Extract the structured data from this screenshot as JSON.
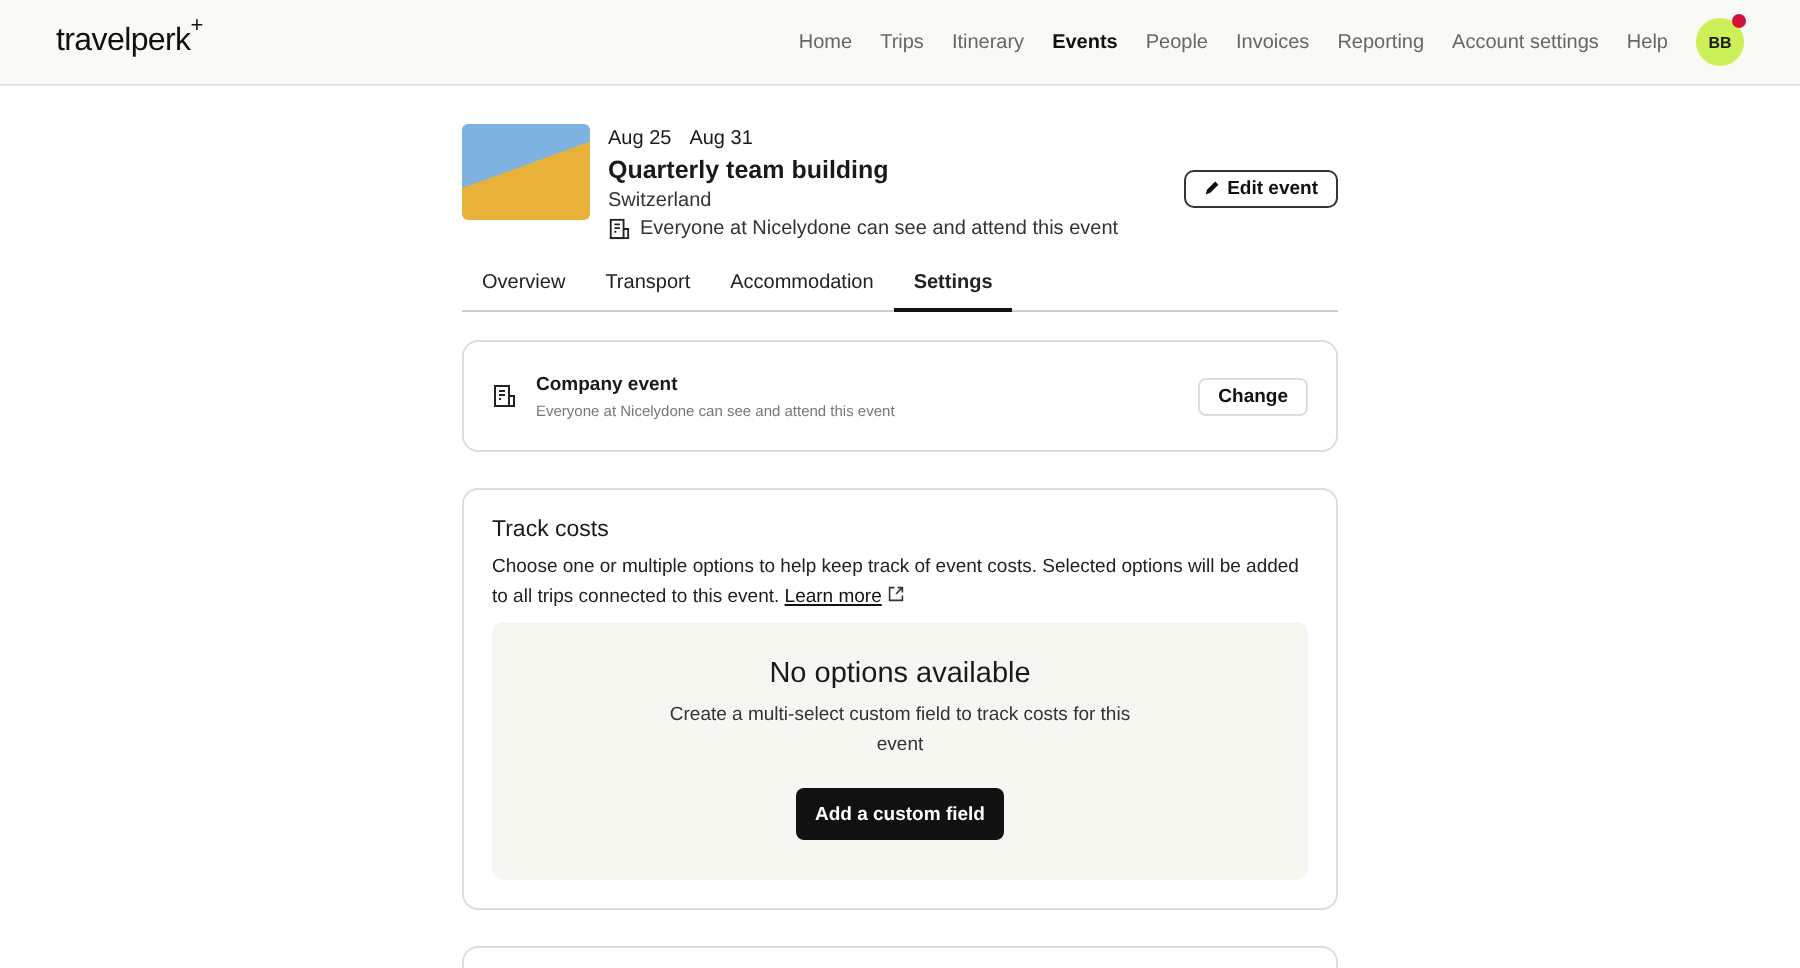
{
  "header": {
    "logo": "travelperk",
    "logo_mark": "+",
    "nav": [
      {
        "label": "Home",
        "selected": false
      },
      {
        "label": "Trips",
        "selected": false
      },
      {
        "label": "Itinerary",
        "selected": false
      },
      {
        "label": "Events",
        "selected": true
      },
      {
        "label": "People",
        "selected": false
      },
      {
        "label": "Invoices",
        "selected": false
      },
      {
        "label": "Reporting",
        "selected": false
      },
      {
        "label": "Account settings",
        "selected": false
      },
      {
        "label": "Help",
        "selected": false
      }
    ],
    "avatar": {
      "initials": "BB",
      "notification": true
    }
  },
  "event": {
    "start": "Aug 25",
    "end": "Aug 31",
    "title": "Quarterly team building",
    "location": "Switzerland",
    "visibility": "Everyone at Nicelydone can see and attend this event",
    "edit_button": "Edit event"
  },
  "tabs": [
    {
      "label": "Overview",
      "selected": false
    },
    {
      "label": "Transport",
      "selected": false
    },
    {
      "label": "Accommodation",
      "selected": false
    },
    {
      "label": "Settings",
      "selected": true
    }
  ],
  "company_card": {
    "title": "Company event",
    "subtitle": "Everyone at Nicelydone can see and attend this event",
    "button": "Change"
  },
  "track_costs": {
    "title": "Track costs",
    "description": "Choose one or multiple options to help keep track of event costs. Selected options will be added to all trips connected to this event.",
    "link": "Learn more",
    "empty_title": "No options available",
    "empty_text": "Create a multi-select custom field to track costs for this event",
    "button": "Add a custom field"
  }
}
